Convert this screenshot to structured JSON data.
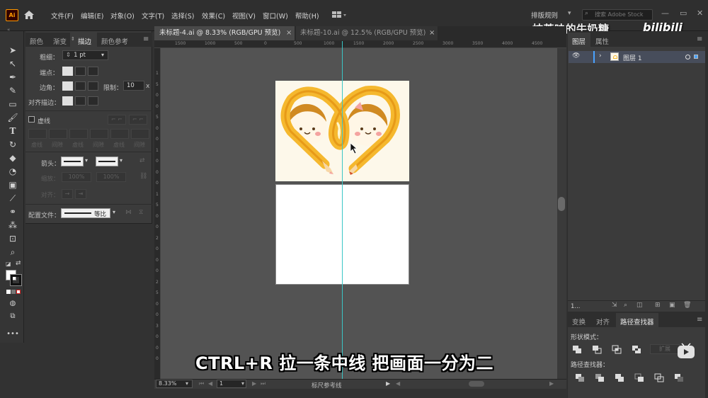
{
  "app": {
    "logo": "Ai",
    "menu": [
      "文件(F)",
      "编辑(E)",
      "对象(O)",
      "文字(T)",
      "选择(S)",
      "效果(C)",
      "视图(V)",
      "窗口(W)",
      "帮助(H)"
    ],
    "workspace": "排版规则",
    "search_placeholder": "搜索 Adobe Stock",
    "uploader_watermark": "抹茶味的牛奶糖_",
    "site_logo": "bilibili"
  },
  "documents": {
    "tabs": [
      {
        "label": "未标题-4.ai @ 8.33% (RGB/GPU 预览)",
        "active": true
      },
      {
        "label": "未标题-10.ai @ 12.5% (RGB/GPU 预览)",
        "active": false
      }
    ],
    "close_glyph": "×"
  },
  "stroke_panel": {
    "tabs": [
      "颜色",
      "渐变",
      "描边",
      "颜色参考"
    ],
    "active_tab": "描边",
    "weight_label": "粗细：",
    "weight_value": "1 pt",
    "cap_label": "端点：",
    "corner_label": "边角：",
    "limit_label": "限制：",
    "limit_value": "10",
    "limit_unit": "x",
    "align_label": "对齐描边：",
    "dashed_label": "虚线",
    "dash_fields": [
      "虚线",
      "间隙",
      "虚线",
      "间隙",
      "虚线",
      "间隙"
    ],
    "arrow_label": "箭头：",
    "scale_label": "缩放：",
    "scale_values": [
      "100%",
      "100%"
    ],
    "align_arrow_label": "对齐：",
    "profile_label": "配置文件：",
    "profile_value": "等比"
  },
  "rulers": {
    "h_ticks": [
      "1500",
      "1000",
      "500",
      "0",
      "500",
      "1000",
      "1500",
      "2000",
      "2500",
      "3000",
      "3500",
      "4000",
      "4500"
    ],
    "v_ticks": [
      "1",
      "5",
      "0",
      "0",
      "5",
      "0",
      "0",
      "1",
      "0",
      "0",
      "0",
      "1",
      "5",
      "0",
      "0",
      "2",
      "0",
      "0",
      "0",
      "2",
      "5",
      "0",
      "0",
      "3",
      "0",
      "0",
      "0"
    ]
  },
  "status": {
    "zoom": "8.33%",
    "artboard": "1",
    "tool_text": "标尺参考线"
  },
  "layers_panel": {
    "tabs": [
      "图层",
      "属性"
    ],
    "layer_name": "图层 1",
    "layer_count": "1..."
  },
  "pathfinder_panel": {
    "tabs": [
      "变换",
      "对齐",
      "路径查找器"
    ],
    "shape_modes_label": "形状模式：",
    "expand_label": "扩展",
    "pathfinders_label": "路径查找器："
  },
  "subtitle": "CTRL+R 拉一条中线 把画面一分为二",
  "colors": {
    "guide": "#3ac6c6",
    "accent_orange": "#f5b82e",
    "artboard_bg": "#fdf8ea"
  }
}
